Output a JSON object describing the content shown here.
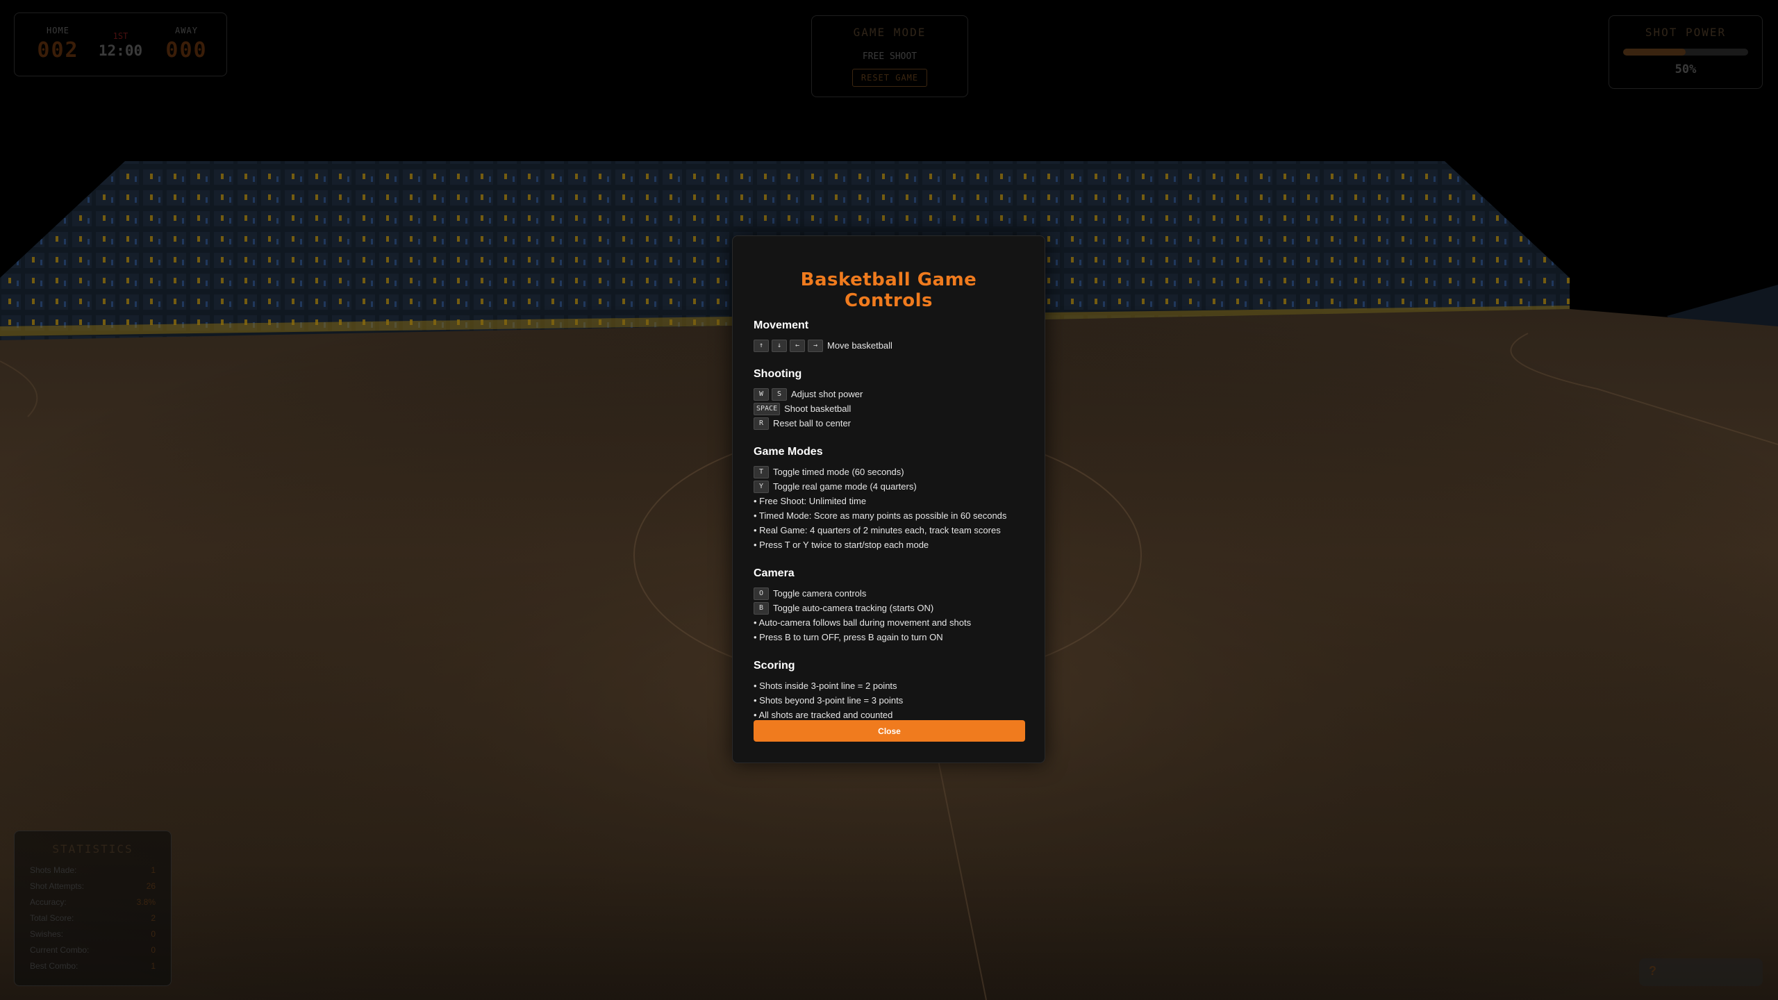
{
  "scoreboard": {
    "home_label": "HOME",
    "home_score": "002",
    "quarter": "1ST",
    "clock": "12:00",
    "away_label": "AWAY",
    "away_score": "000"
  },
  "game_mode": {
    "title": "GAME MODE",
    "current": "FREE SHOOT",
    "reset_label": "RESET GAME"
  },
  "shot_power": {
    "title": "SHOT POWER",
    "percent": 50,
    "display": "50%"
  },
  "statistics": {
    "title": "STATISTICS",
    "rows": [
      {
        "label": "Shots Made:",
        "value": "1"
      },
      {
        "label": "Shot Attempts:",
        "value": "26"
      },
      {
        "label": "Accuracy:",
        "value": "3.8%"
      },
      {
        "label": "Total Score:",
        "value": "2"
      },
      {
        "label": "Swishes:",
        "value": "0"
      },
      {
        "label": "Current Combo:",
        "value": "0"
      },
      {
        "label": "Best Combo:",
        "value": "1"
      }
    ]
  },
  "help_button": {
    "label": "?"
  },
  "modal": {
    "title": "Basketball Game Controls",
    "movement": {
      "title": "Movement",
      "keys": [
        "↑",
        "↓",
        "←",
        "→"
      ],
      "text": "Move basketball"
    },
    "shooting": {
      "title": "Shooting",
      "rows": [
        {
          "keys": [
            "W",
            "S"
          ],
          "text": "Adjust shot power"
        },
        {
          "keys": [
            "SPACE"
          ],
          "text": "Shoot basketball"
        },
        {
          "keys": [
            "R"
          ],
          "text": "Reset ball to center"
        }
      ]
    },
    "game_modes": {
      "title": "Game Modes",
      "rows": [
        {
          "keys": [
            "T"
          ],
          "text": "Toggle timed mode (60 seconds)"
        },
        {
          "keys": [
            "Y"
          ],
          "text": "Toggle real game mode (4 quarters)"
        }
      ],
      "bullets": [
        "• Free Shoot: Unlimited time",
        "• Timed Mode: Score as many points as possible in 60 seconds",
        "• Real Game: 4 quarters of 2 minutes each, track team scores",
        "• Press T or Y twice to start/stop each mode"
      ]
    },
    "camera": {
      "title": "Camera",
      "rows": [
        {
          "keys": [
            "O"
          ],
          "text": "Toggle camera controls"
        },
        {
          "keys": [
            "B"
          ],
          "text": "Toggle auto-camera tracking (starts ON)"
        }
      ],
      "bullets": [
        "• Auto-camera follows ball during movement and shots",
        "• Press B to turn OFF, press B again to turn ON"
      ]
    },
    "scoring": {
      "title": "Scoring",
      "bullets": [
        "• Shots inside 3-point line = 2 points",
        "• Shots beyond 3-point line = 3 points",
        "• All shots are tracked and counted"
      ]
    },
    "close_label": "Close"
  },
  "colors": {
    "accent": "#f07b1e",
    "modal_bg": "#141414",
    "court": "#3a2a1c",
    "seats": "#1c2a3c",
    "seat_highlight": "#b08a1a"
  }
}
